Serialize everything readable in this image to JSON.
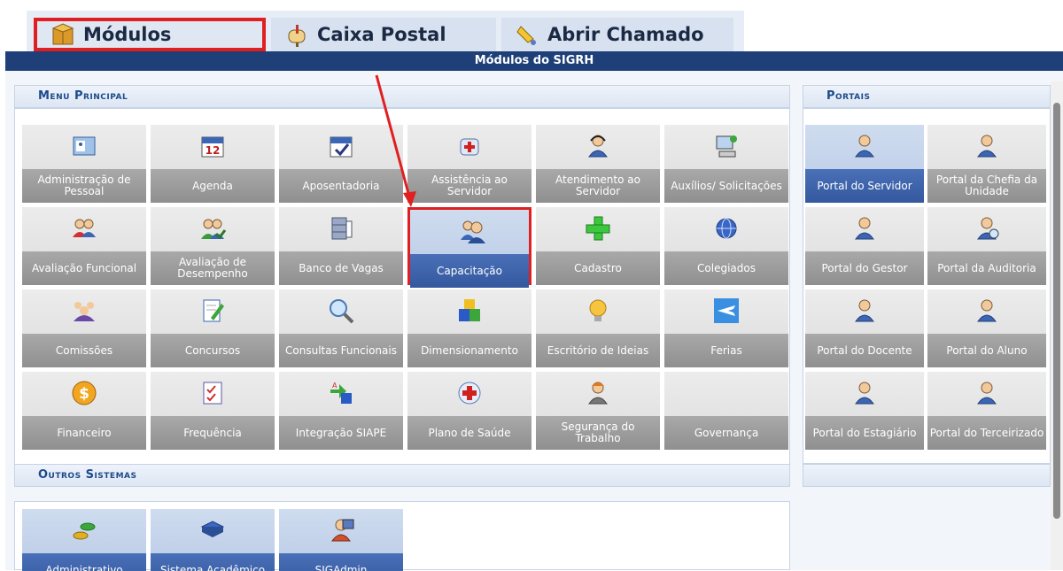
{
  "tabs": [
    {
      "label": "Módulos",
      "icon": "box-icon",
      "selected": true
    },
    {
      "label": "Caixa Postal",
      "icon": "mailbox-icon",
      "selected": false
    },
    {
      "label": "Abrir Chamado",
      "icon": "bell-icon",
      "selected": false
    }
  ],
  "window": {
    "title": "Módulos do SIGRH"
  },
  "sections": {
    "menu": "Menu Principal",
    "portais": "Portais",
    "outros": "Outros Sistemas"
  },
  "menu_items": [
    {
      "label": "Administração de Pessoal",
      "icon": "personnel-admin-icon"
    },
    {
      "label": "Agenda",
      "icon": "calendar-icon"
    },
    {
      "label": "Aposentadoria",
      "icon": "calendar-check-icon"
    },
    {
      "label": "Assistência ao Servidor",
      "icon": "first-aid-icon"
    },
    {
      "label": "Atendimento ao Servidor",
      "icon": "headset-user-icon"
    },
    {
      "label": "Auxílios/ Solicitações",
      "icon": "computer-icon"
    },
    {
      "label": "Avaliação Funcional",
      "icon": "users-icon"
    },
    {
      "label": "Avaliação de Desempenho",
      "icon": "users-check-icon"
    },
    {
      "label": "Banco de Vagas",
      "icon": "database-icon"
    },
    {
      "label": "Capacitação",
      "icon": "group-icon"
    },
    {
      "label": "Cadastro",
      "icon": "plus-icon"
    },
    {
      "label": "Colegiados",
      "icon": "globe-icon"
    },
    {
      "label": "Comissões",
      "icon": "team-icon"
    },
    {
      "label": "Concursos",
      "icon": "document-edit-icon"
    },
    {
      "label": "Consultas Funcionais",
      "icon": "magnifier-icon"
    },
    {
      "label": "Dimensionamento",
      "icon": "blocks-icon"
    },
    {
      "label": "Escritório de Ideias",
      "icon": "lightbulb-icon"
    },
    {
      "label": "Ferias",
      "icon": "airplane-icon"
    },
    {
      "label": "Financeiro",
      "icon": "dollar-coin-icon"
    },
    {
      "label": "Frequência",
      "icon": "checklist-icon"
    },
    {
      "label": "Integração SIAPE",
      "icon": "sync-icon"
    },
    {
      "label": "Plano de Saúde",
      "icon": "health-cross-icon"
    },
    {
      "label": "Segurança do Trabalho",
      "icon": "worker-icon"
    },
    {
      "label": "Governança",
      "icon": ""
    }
  ],
  "portais": [
    {
      "label": "Portal do Servidor",
      "icon": "user-icon"
    },
    {
      "label": "Portal da Chefia da Unidade",
      "icon": "user-icon"
    },
    {
      "label": "Portal do Gestor",
      "icon": "user-icon"
    },
    {
      "label": "Portal da Auditoria",
      "icon": "user-search-icon"
    },
    {
      "label": "Portal do Docente",
      "icon": "user-icon"
    },
    {
      "label": "Portal do Aluno",
      "icon": "user-icon"
    },
    {
      "label": "Portal do Estagiário",
      "icon": "user-icon"
    },
    {
      "label": "Portal do Terceirizado",
      "icon": "user-icon"
    }
  ],
  "outros": [
    {
      "label": "Administrativo",
      "icon": "coins-icon"
    },
    {
      "label": "Sistema Acadêmico",
      "icon": "book-icon"
    },
    {
      "label": "SIGAdmin",
      "icon": "admin-user-icon"
    }
  ],
  "colors": {
    "titlebar": "#1e3f78",
    "highlight": "#e02020",
    "section_text": "#1c4a8a"
  }
}
